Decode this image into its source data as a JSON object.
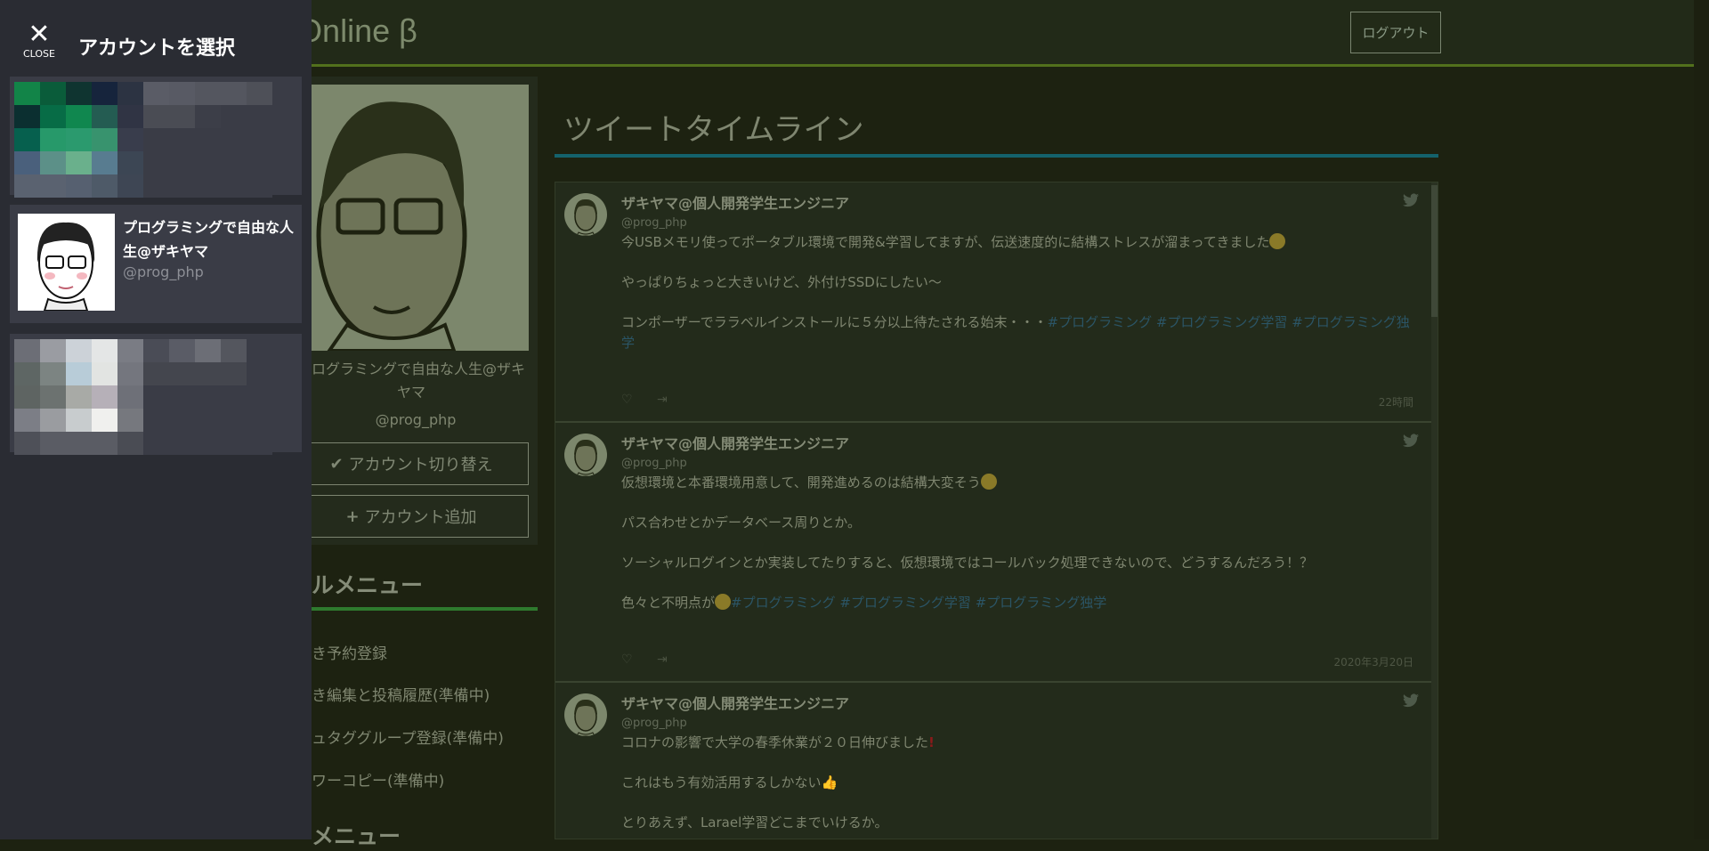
{
  "header": {
    "logo": "Tweet Online β",
    "logout": "ログアウト"
  },
  "profile": {
    "name": "プログラミングで自由な人生@ザキヤマ",
    "handle": "@prog_php",
    "switch_label": "アカウント切り替え",
    "add_label": "アカウント追加"
  },
  "menu": {
    "heading": "ルメニュー",
    "items": [
      "き予約登録",
      "き編集と投稿履歴(準備中)",
      "ュタググループ登録(準備中)",
      "ワーコピー(準備中)"
    ],
    "heading2": "メニュー"
  },
  "timeline": {
    "title": "ツイートタイムライン",
    "tweets": [
      {
        "name": "ザキヤマ@個人開発学生エンジニア",
        "handle": "@prog_php",
        "lines": [
          "今USBメモリ使ってポータブル環境で開発&学習してますが、伝送速度的に結構ストレスが溜まってきました",
          "",
          "やっぱりちょっと大きいけど、外付けSSDにしたい〜",
          "",
          "コンポーザーでララベルインストールに５分以上待たされる始末・・・"
        ],
        "tags": "#プログラミング #プログラミング学習 #プログラミング独学",
        "time": "22時間"
      },
      {
        "name": "ザキヤマ@個人開発学生エンジニア",
        "handle": "@prog_php",
        "lines": [
          "仮想環境と本番環境用意して、開発進めるのは結構大変そう",
          "",
          "パス合わせとかデータベース周りとか。",
          "",
          "ソーシャルログインとか実装してたりすると、仮想環境ではコールバック処理できないので、どうするんだろう！？",
          "",
          "色々と不明点が"
        ],
        "tags": "#プログラミング #プログラミング学習 #プログラミング独学",
        "time": "2020年3月20日"
      },
      {
        "name": "ザキヤマ@個人開発学生エンジニア",
        "handle": "@prog_php",
        "lines": [
          "コロナの影響で大学の春季休業が２０日伸びました",
          "",
          "これはもう有効活用するしかない",
          "",
          "とりあえず、Larael学習どこまでいけるか。"
        ],
        "tags": "",
        "time": ""
      }
    ]
  },
  "drawer": {
    "close_label": "CLOSE",
    "title": "アカウントを選択",
    "accounts": [
      {
        "name": "",
        "handle": ""
      },
      {
        "name": "プログラミングで自由な人生@ザキヤマ",
        "handle": "@prog_php"
      },
      {
        "name": "",
        "handle": ""
      }
    ]
  },
  "colors": {
    "accent_header": "#52701c",
    "accent_timeline": "#14626c",
    "accent_menu": "#2e7a2e",
    "drawer_bg": "#2a2c33"
  }
}
